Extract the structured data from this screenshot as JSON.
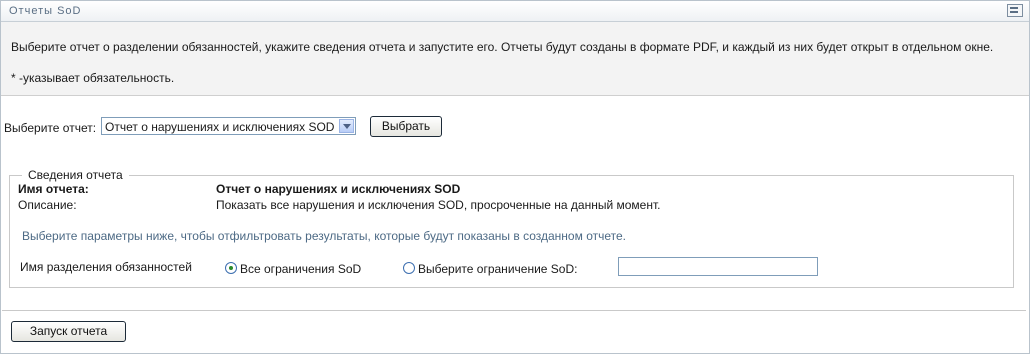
{
  "portlet": {
    "title": "Отчеты SoD"
  },
  "intro": {
    "description": "Выберите отчет о разделении обязанностей, укажите сведения отчета и запустите его. Отчеты будут созданы в формате PDF, и каждый из них будет открыт в отдельном окне.",
    "required_note": "* -указывает обязательность."
  },
  "report_select": {
    "label": "Выберите отчет:",
    "selected_value": "Отчет о нарушениях и исключениях SOD",
    "button_label": "Выбрать"
  },
  "details": {
    "legend": "Сведения отчета",
    "name_label": "Имя отчета:",
    "name_value": "Отчет о нарушениях и исключениях SOD",
    "desc_label": "Описание:",
    "desc_value": "Показать все нарушения и исключения SOD, просроченные на данный момент.",
    "filter_hint": "Выберите параметры ниже, чтобы отфильтровать результаты, которые будут показаны в созданном отчете.",
    "sod_name_label": "Имя разделения обязанностей",
    "option_all": "Все ограничения SoD",
    "option_choose": "Выберите ограничение SoD:",
    "selected_option": "all",
    "choose_value": ""
  },
  "actions": {
    "run_label": "Запуск отчета"
  }
}
